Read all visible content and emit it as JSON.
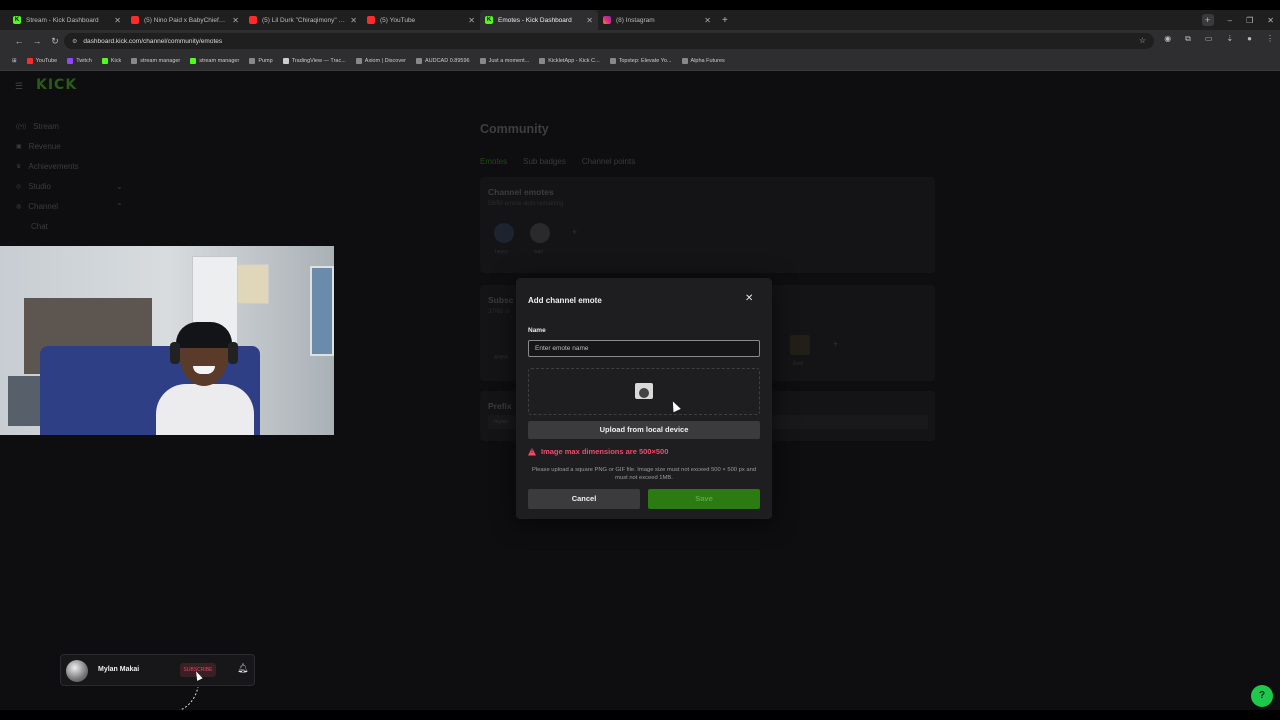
{
  "browser": {
    "tabs": [
      {
        "title": "Stream - Kick Dashboard",
        "icon": "kick-icon",
        "active": false
      },
      {
        "title": "(5) Nino Paid x BabyChiefDoit",
        "icon": "youtube-icon",
        "active": false
      },
      {
        "title": "(5) Lil Durk \"Chiraqimony\" (W...",
        "icon": "youtube-icon",
        "active": false
      },
      {
        "title": "(5) YouTube",
        "icon": "youtube-icon",
        "active": false
      },
      {
        "title": "Emotes - Kick Dashboard",
        "icon": "kick-icon",
        "active": true
      },
      {
        "title": "(8) Instagram",
        "icon": "instagram-icon",
        "active": false
      }
    ],
    "url": "dashboard.kick.com/channel/community/emotes",
    "bookmarks": [
      {
        "label": "YouTube",
        "icon": "youtube-icon"
      },
      {
        "label": "Twitch",
        "icon": "twitch-icon"
      },
      {
        "label": "Kick",
        "icon": "kick-icon"
      },
      {
        "label": "stream manager",
        "icon": "bookmark-icon"
      },
      {
        "label": "stream manager",
        "icon": "kick-icon"
      },
      {
        "label": "Pump",
        "icon": "bookmark-icon"
      },
      {
        "label": "TradingView — Trac...",
        "icon": "tradingview-icon"
      },
      {
        "label": "Axiom | Discover",
        "icon": "bookmark-icon"
      },
      {
        "label": "AUDCAD 0.89596",
        "icon": "bookmark-icon"
      },
      {
        "label": "Just a moment...",
        "icon": "bookmark-icon"
      },
      {
        "label": "KickletApp - Kick C...",
        "icon": "bookmark-icon"
      },
      {
        "label": "Topstep: Elevate Yo...",
        "icon": "bookmark-icon"
      },
      {
        "label": "Alpha Futures",
        "icon": "bookmark-icon"
      }
    ]
  },
  "sidebar": {
    "logo": "KICK",
    "items": [
      {
        "label": "Stream"
      },
      {
        "label": "Revenue"
      },
      {
        "label": "Achievements"
      },
      {
        "label": "Studio"
      },
      {
        "label": "Channel"
      },
      {
        "label": "Chat"
      }
    ]
  },
  "main": {
    "title": "Community",
    "tabs": [
      {
        "label": "Emotes"
      },
      {
        "label": "Sub badges"
      },
      {
        "label": "Channel points"
      }
    ],
    "channel_emotes": {
      "heading": "Channel emotes",
      "subtext": "58/60 emote slots remaining",
      "emotes": [
        {
          "label": "heyyy"
        },
        {
          "label": "wait"
        }
      ]
    },
    "subscriber_heading": "Subsc",
    "subscriber_subtext": "37/60 sl",
    "sub_emotes": [
      {
        "label": "AHHH"
      },
      {
        "label": "Emil"
      }
    ],
    "prefix_heading": "Prefix",
    "prefix_value": "mylan"
  },
  "modal": {
    "title": "Add channel emote",
    "name_label": "Name",
    "name_placeholder": "Enter emote name",
    "upload_label": "Upload from local device",
    "error": "Image max dimensions are 500×500",
    "hint": "Please upload a square PNG or GIF file. Image size must not exceed 500 × 500 px and must not exceed 1MB.",
    "cancel_label": "Cancel",
    "save_label": "Save"
  },
  "sub_widget": {
    "username": "Mylan Makai",
    "button_label": "SUBSCRIBE"
  },
  "colors": {
    "kick_green": "#53fc18",
    "save_green": "#2c7a12",
    "error_red": "#f14a6b",
    "modal_bg": "#1e1e20"
  }
}
